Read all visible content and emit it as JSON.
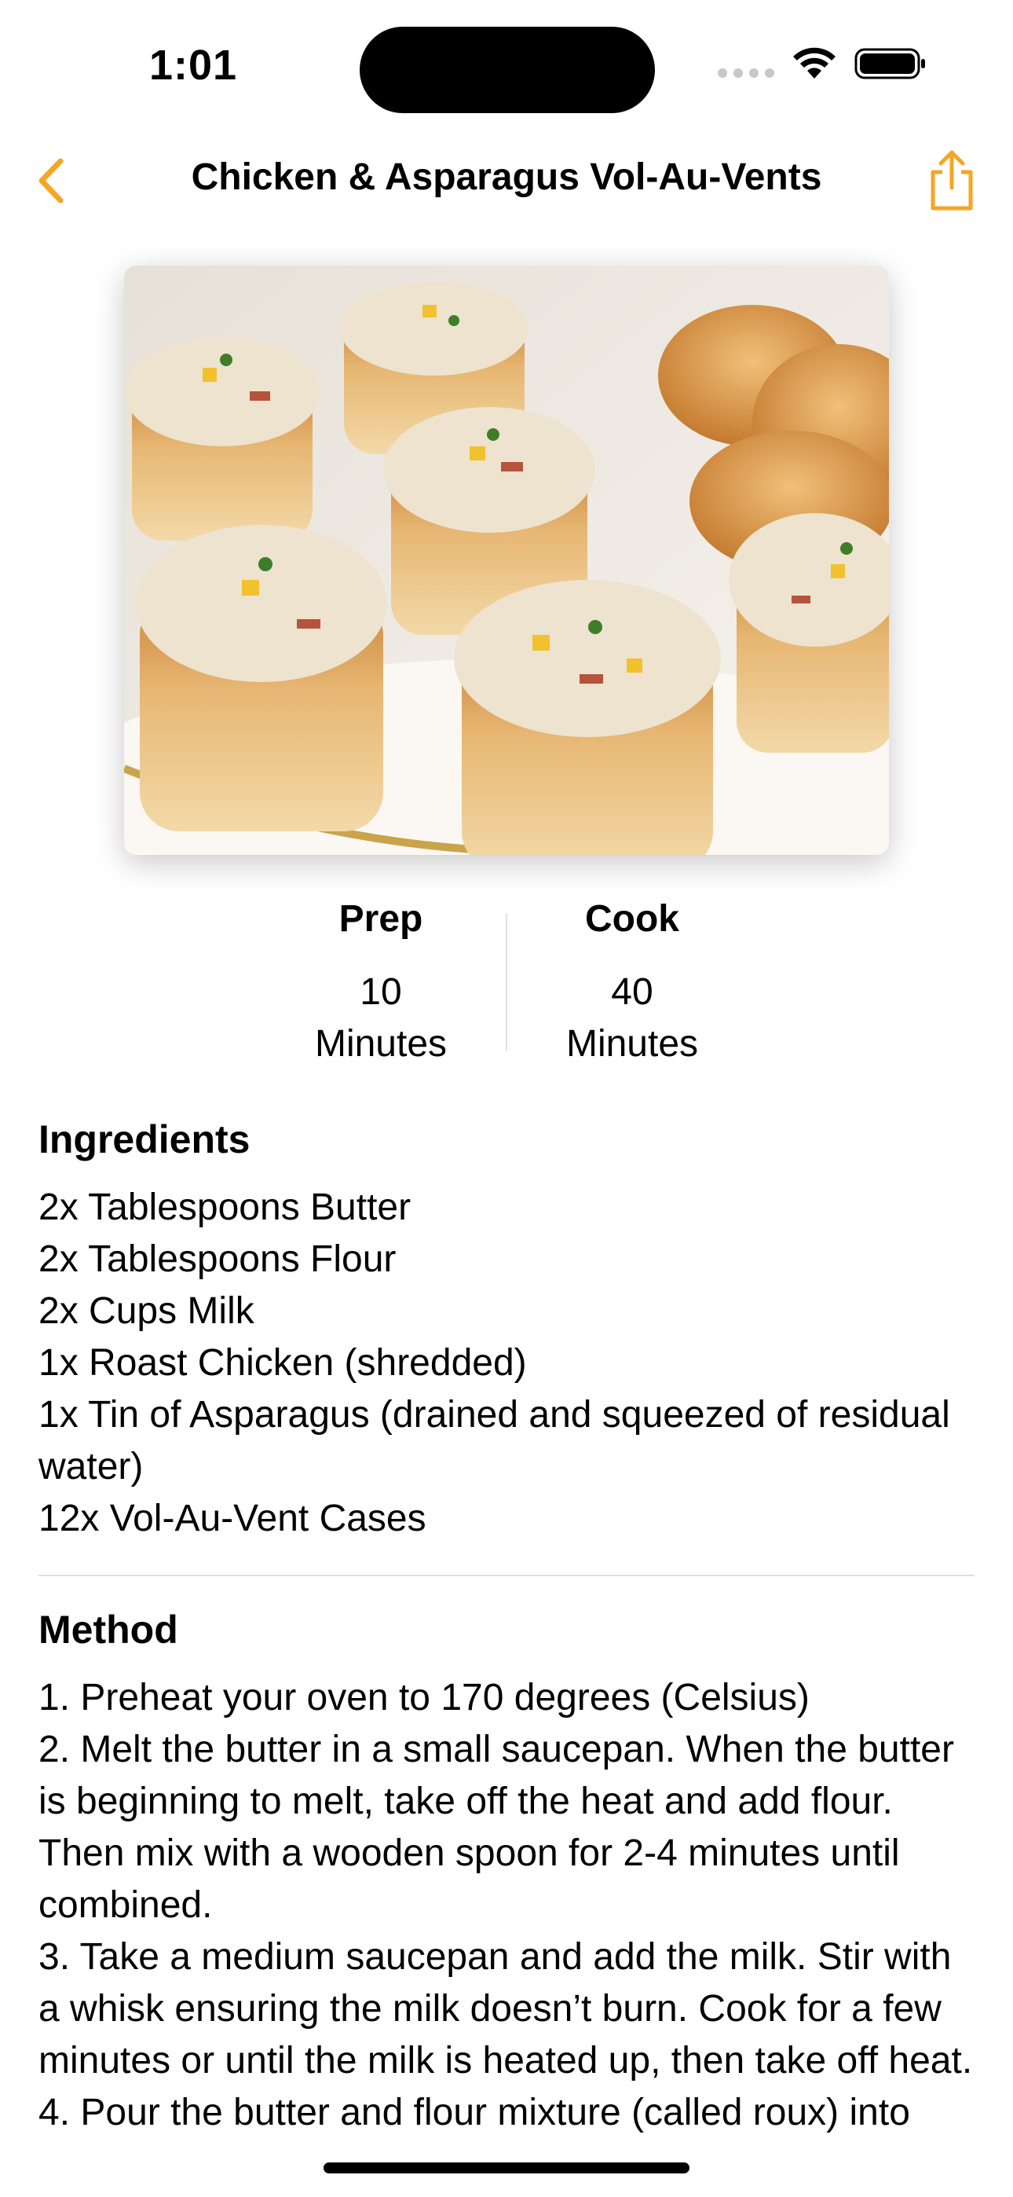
{
  "status_bar": {
    "time": "1:01",
    "icons": [
      "cellular-signal-icon",
      "wifi-icon",
      "battery-icon"
    ]
  },
  "nav": {
    "title": "Chicken & Asparagus Vol-Au-Vents",
    "back_icon": "chevron-left-icon",
    "share_icon": "share-icon",
    "accent_color": "#F5A623"
  },
  "hero_image": {
    "subject": "vol-au-vent pastry cases filled with creamy chicken mixture"
  },
  "times": {
    "prep": {
      "heading": "Prep",
      "value": "10",
      "unit": "Minutes"
    },
    "cook": {
      "heading": "Cook",
      "value": "40",
      "unit": "Minutes"
    }
  },
  "ingredients": {
    "heading": "Ingredients",
    "items": [
      "2x Tablespoons Butter",
      "2x Tablespoons Flour",
      "2x Cups Milk",
      "1x Roast Chicken (shredded)",
      "1x Tin of Asparagus (drained and squeezed of residual water)",
      "12x Vol-Au-Vent Cases"
    ]
  },
  "method": {
    "heading": "Method",
    "steps": [
      "1. Preheat your oven to 170 degrees (Celsius)",
      "2. Melt the butter in a small saucepan. When the butter is beginning to melt, take off the heat and add flour. Then mix with a wooden spoon for 2-4 minutes until combined.",
      "3. Take a medium saucepan and add the milk. Stir with a whisk ensuring the milk doesn’t burn. Cook for a few minutes or until the milk is heated up, then take off heat.",
      "4. Pour the butter and flour mixture (called roux) into"
    ]
  }
}
